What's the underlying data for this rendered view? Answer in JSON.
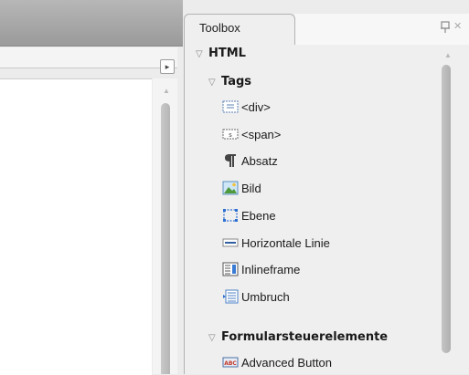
{
  "toolbox": {
    "title": "Toolbox",
    "pin_icon": "pin-icon",
    "close_icon": "close-icon",
    "categories": [
      {
        "label": "HTML",
        "subcategories": [
          {
            "label": "Tags",
            "items": [
              {
                "label": "<div>",
                "icon": "div-icon"
              },
              {
                "label": "<span>",
                "icon": "span-icon"
              },
              {
                "label": "Absatz",
                "icon": "paragraph-icon"
              },
              {
                "label": "Bild",
                "icon": "image-icon"
              },
              {
                "label": "Ebene",
                "icon": "layer-icon"
              },
              {
                "label": "Horizontale Linie",
                "icon": "horizontal-rule-icon"
              },
              {
                "label": "Inlineframe",
                "icon": "iframe-icon"
              },
              {
                "label": "Umbruch",
                "icon": "line-break-icon"
              }
            ]
          },
          {
            "label": "Formularsteuerelemente",
            "items": [
              {
                "label": "Advanced Button",
                "icon": "button-icon"
              }
            ]
          }
        ]
      }
    ]
  },
  "document": {
    "scroll_arrow": "▸"
  },
  "colors": {
    "panel_bg": "#efefef",
    "header_gray": "#a8a8a8",
    "doc_bg": "#ffffff",
    "scroll_thumb": "#bcbcbc"
  }
}
